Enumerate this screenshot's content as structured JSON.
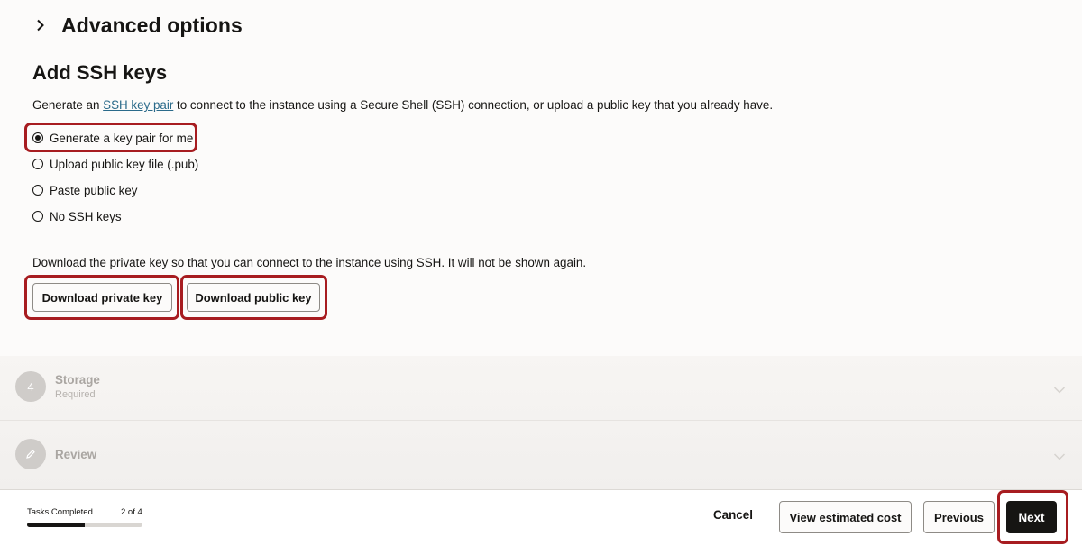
{
  "advanced": {
    "title": "Advanced options",
    "chevron_icon": "chevron-right-icon"
  },
  "ssh": {
    "title": "Add SSH keys",
    "description_prefix": "Generate an ",
    "description_link": "SSH key pair",
    "description_suffix": " to connect to the instance using a Secure Shell (SSH) connection, or upload a public key that you already have.",
    "options": [
      {
        "label": "Generate a key pair for me",
        "selected": true
      },
      {
        "label": "Upload public key file (.pub)",
        "selected": false
      },
      {
        "label": "Paste public key",
        "selected": false
      },
      {
        "label": "No SSH keys",
        "selected": false
      }
    ],
    "download_note": "Download the private key so that you can connect to the instance using SSH. It will not be shown again.",
    "download_private_label": "Download private key",
    "download_public_label": "Download public key"
  },
  "steps": [
    {
      "badge": "4",
      "title": "Storage",
      "subtitle": "Required"
    },
    {
      "badge_icon": "pencil-icon",
      "title": "Review"
    }
  ],
  "footer": {
    "tasks_label": "Tasks Completed",
    "tasks_count": "2 of 4",
    "progress": 0.5,
    "cancel_label": "Cancel",
    "view_cost_label": "View estimated cost",
    "previous_label": "Previous",
    "next_label": "Next"
  },
  "colors": {
    "highlight": "#a71c20",
    "link": "#2a6a8a",
    "primary_button": "#161513"
  }
}
